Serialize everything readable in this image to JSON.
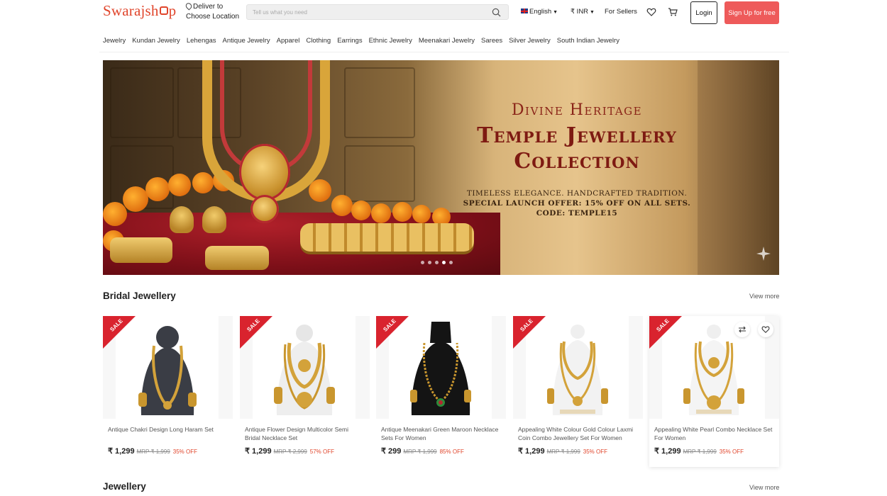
{
  "header": {
    "logo": "Swarajshop",
    "deliver_line1": "Deliver to",
    "deliver_line2": "Choose Location",
    "search_placeholder": "Tell us what you need",
    "language": "English",
    "currency": "₹ INR",
    "for_sellers": "For Sellers",
    "login": "Login",
    "signup": "Sign Up for free"
  },
  "categories": [
    "Jewelry",
    "Kundan Jewelry",
    "Lehengas",
    "Antique Jewelry",
    "Apparel",
    "Clothing",
    "Earrings",
    "Ethnic Jewelry",
    "Meenakari Jewelry",
    "Sarees",
    "Silver Jewelry",
    "South Indian Jewelry"
  ],
  "hero": {
    "kicker": "Divine Heritage",
    "title_line1": "Temple Jewellery",
    "title_line2": "Collection",
    "subtitle": "TIMELESS ELEGANCE. HANDCRAFTED TRADITION.",
    "offer": "SPECIAL LAUNCH OFFER: 15% OFF ON ALL SETS.",
    "code": "CODE: TEMPLE15",
    "slide_count": 5,
    "active_slide": 4
  },
  "sections": {
    "bridal": {
      "title": "Bridal Jewellery",
      "view_more": "View more"
    },
    "jewellery": {
      "title": "Jewellery",
      "view_more": "View more"
    }
  },
  "sale_badge": "SALE",
  "products": [
    {
      "name": "Antique Chakri Design Long Haram Set",
      "price": "₹ 1,299",
      "mrp": "MRP ₹ 1,999",
      "off": "35% OFF",
      "bust_color": "#3a3d45"
    },
    {
      "name": "Antique Flower Design Multicolor Semi Bridal Necklace Set",
      "price": "₹ 1,299",
      "mrp": "MRP ₹ 2,999",
      "off": "57% OFF",
      "bust_color": "#f2f2f2"
    },
    {
      "name": "Antique Meenakari Green Maroon Necklace Sets For Women",
      "price": "₹ 299",
      "mrp": "MRP ₹ 1,999",
      "off": "85% OFF",
      "bust_color": "#141414"
    },
    {
      "name": "Appealing White Colour Gold Colour Laxmi Coin Combo Jewellery Set For Women",
      "price": "₹ 1,299",
      "mrp": "MRP ₹ 1,999",
      "off": "35% OFF",
      "bust_color": "#f4f4f4"
    },
    {
      "name": "Appealing White Pearl Combo Necklace Set For Women",
      "price": "₹ 1,299",
      "mrp": "MRP ₹ 1,999",
      "off": "35% OFF",
      "bust_color": "#f4f4f4"
    }
  ],
  "colors": {
    "brand": "#e0452b",
    "signup": "#ee5a5a",
    "gold": "#d9a53a",
    "maroon": "#7e1a12"
  }
}
